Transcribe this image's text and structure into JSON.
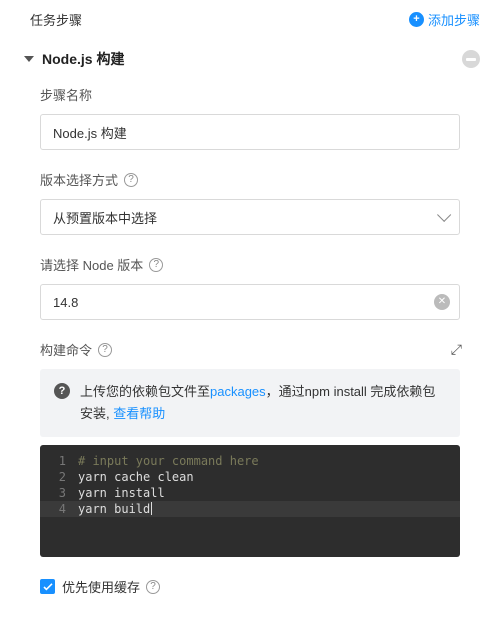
{
  "header": {
    "title": "任务步骤",
    "add_step": "添加步骤"
  },
  "section": {
    "title": "Node.js 构建"
  },
  "fields": {
    "step_name": {
      "label": "步骤名称",
      "value": "Node.js 构建"
    },
    "version_method": {
      "label": "版本选择方式",
      "selected": "从预置版本中选择"
    },
    "node_version": {
      "label": "请选择 Node 版本",
      "value": "14.8"
    },
    "build_command": {
      "label": "构建命令"
    }
  },
  "tip": {
    "pre": "上传您的依赖包文件至",
    "link1": "packages",
    "mid": "，通过npm install 完成依赖包安装,  ",
    "link2": "查看帮助"
  },
  "code": {
    "lines": [
      {
        "n": "1",
        "text": "# input your command here",
        "comment": true
      },
      {
        "n": "2",
        "text": "yarn cache clean",
        "comment": false
      },
      {
        "n": "3",
        "text": "yarn install",
        "comment": false
      },
      {
        "n": "4",
        "text": "yarn build",
        "comment": false
      }
    ],
    "active_index": 3
  },
  "cache": {
    "label": "优先使用缓存",
    "checked": true
  }
}
